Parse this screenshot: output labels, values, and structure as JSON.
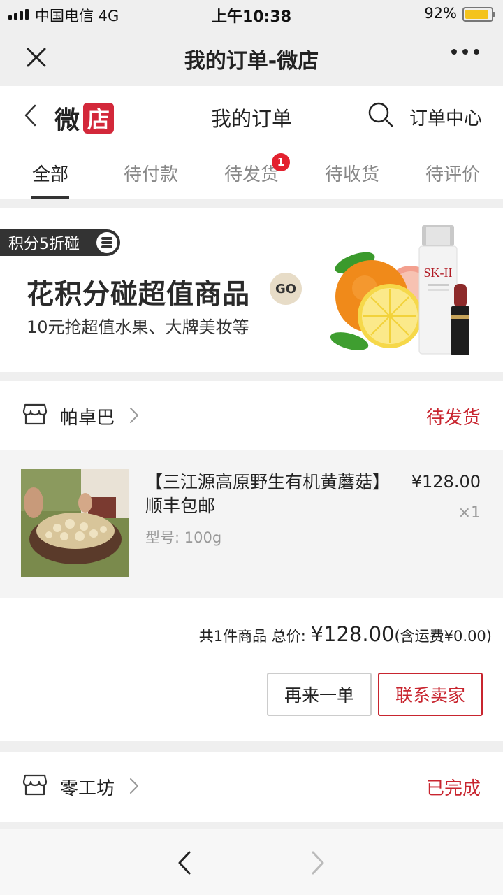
{
  "status_bar": {
    "carrier": "中国电信   4G",
    "time": "上午10:38",
    "battery": "92%",
    "battery_level": 0.92
  },
  "title_bar": {
    "title": "我的订单-微店",
    "close_icon": "close-icon",
    "more_icon": "more-icon"
  },
  "header": {
    "logo_text": "微",
    "logo_badge": "店",
    "page_title": "我的订单",
    "search_icon": "search-icon",
    "order_center": "订单中心"
  },
  "tabs": [
    {
      "label": "全部",
      "active": true
    },
    {
      "label": "待付款"
    },
    {
      "label": "待发货",
      "badge": "1"
    },
    {
      "label": "待收货"
    },
    {
      "label": "待评价"
    }
  ],
  "banner": {
    "tag": "积分5折碰",
    "headline": "花积分碰超值商品",
    "go": "GO",
    "subtitle": "10元抢超值水果、大牌美妆等",
    "product_label": "SK-II"
  },
  "orders": [
    {
      "shop": "帕卓巴",
      "status": "待发货",
      "product_name": "【三江源高原野生有机黄蘑菇】顺丰包邮",
      "spec": "型号: 100g",
      "price": "¥128.00",
      "qty": "×1",
      "summary_prefix": "共1件商品 总价: ",
      "total": "¥128.00",
      "shipping": "(含运费¥0.00)",
      "buttons": {
        "reorder": "再来一单",
        "contact": "联系卖家"
      }
    },
    {
      "shop": "零工坊",
      "status": "已完成"
    }
  ],
  "colors": {
    "accent": "#c8252f",
    "brand_red": "#d3283a",
    "badge_red": "#e3212f"
  }
}
